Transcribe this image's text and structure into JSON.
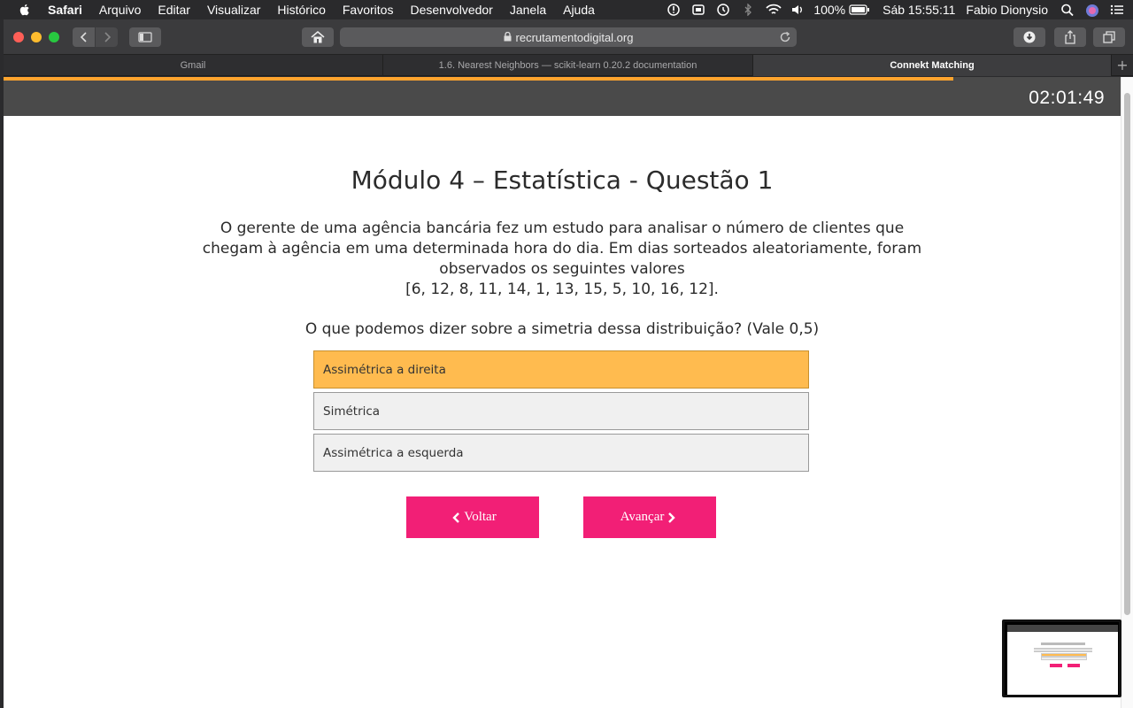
{
  "menubar": {
    "app": "Safari",
    "items": [
      "Arquivo",
      "Editar",
      "Visualizar",
      "Histórico",
      "Favoritos",
      "Desenvolvedor",
      "Janela",
      "Ajuda"
    ],
    "battery": "100%",
    "datetime": "Sáb 15:55:11",
    "user": "Fabio Dionysio"
  },
  "browser": {
    "url": "recrutamentodigital.org",
    "tabs": [
      {
        "title": "Gmail"
      },
      {
        "title": "1.6. Nearest Neighbors — scikit-learn 0.20.2 documentation"
      },
      {
        "title": "Connekt Matching"
      }
    ]
  },
  "exam": {
    "timer": "02:01:49",
    "progress": 0.85,
    "title": "Módulo 4 – Estatística - Questão 1",
    "question_lines": [
      "O gerente de uma agência bancária fez um estudo para analisar o número de clientes que",
      "chegam à agência em uma determinada hora do dia. Em dias sorteados aleatoriamente, foram",
      "observados os seguintes valores",
      "[6, 12, 8, 11, 14, 1, 13, 15, 5, 10, 16, 12]."
    ],
    "prompt": "O que podemos dizer sobre a simetria dessa distribuição? (Vale 0,5)",
    "options": [
      {
        "label": "Assimétrica a direita",
        "selected": true
      },
      {
        "label": "Simétrica",
        "selected": false
      },
      {
        "label": "Assimétrica a esquerda",
        "selected": false
      }
    ],
    "back_label": "Voltar",
    "next_label": "Avançar",
    "colors": {
      "accent": "#f21f76",
      "selected": "#ffbb4f",
      "progress": "#ffa42e"
    }
  }
}
